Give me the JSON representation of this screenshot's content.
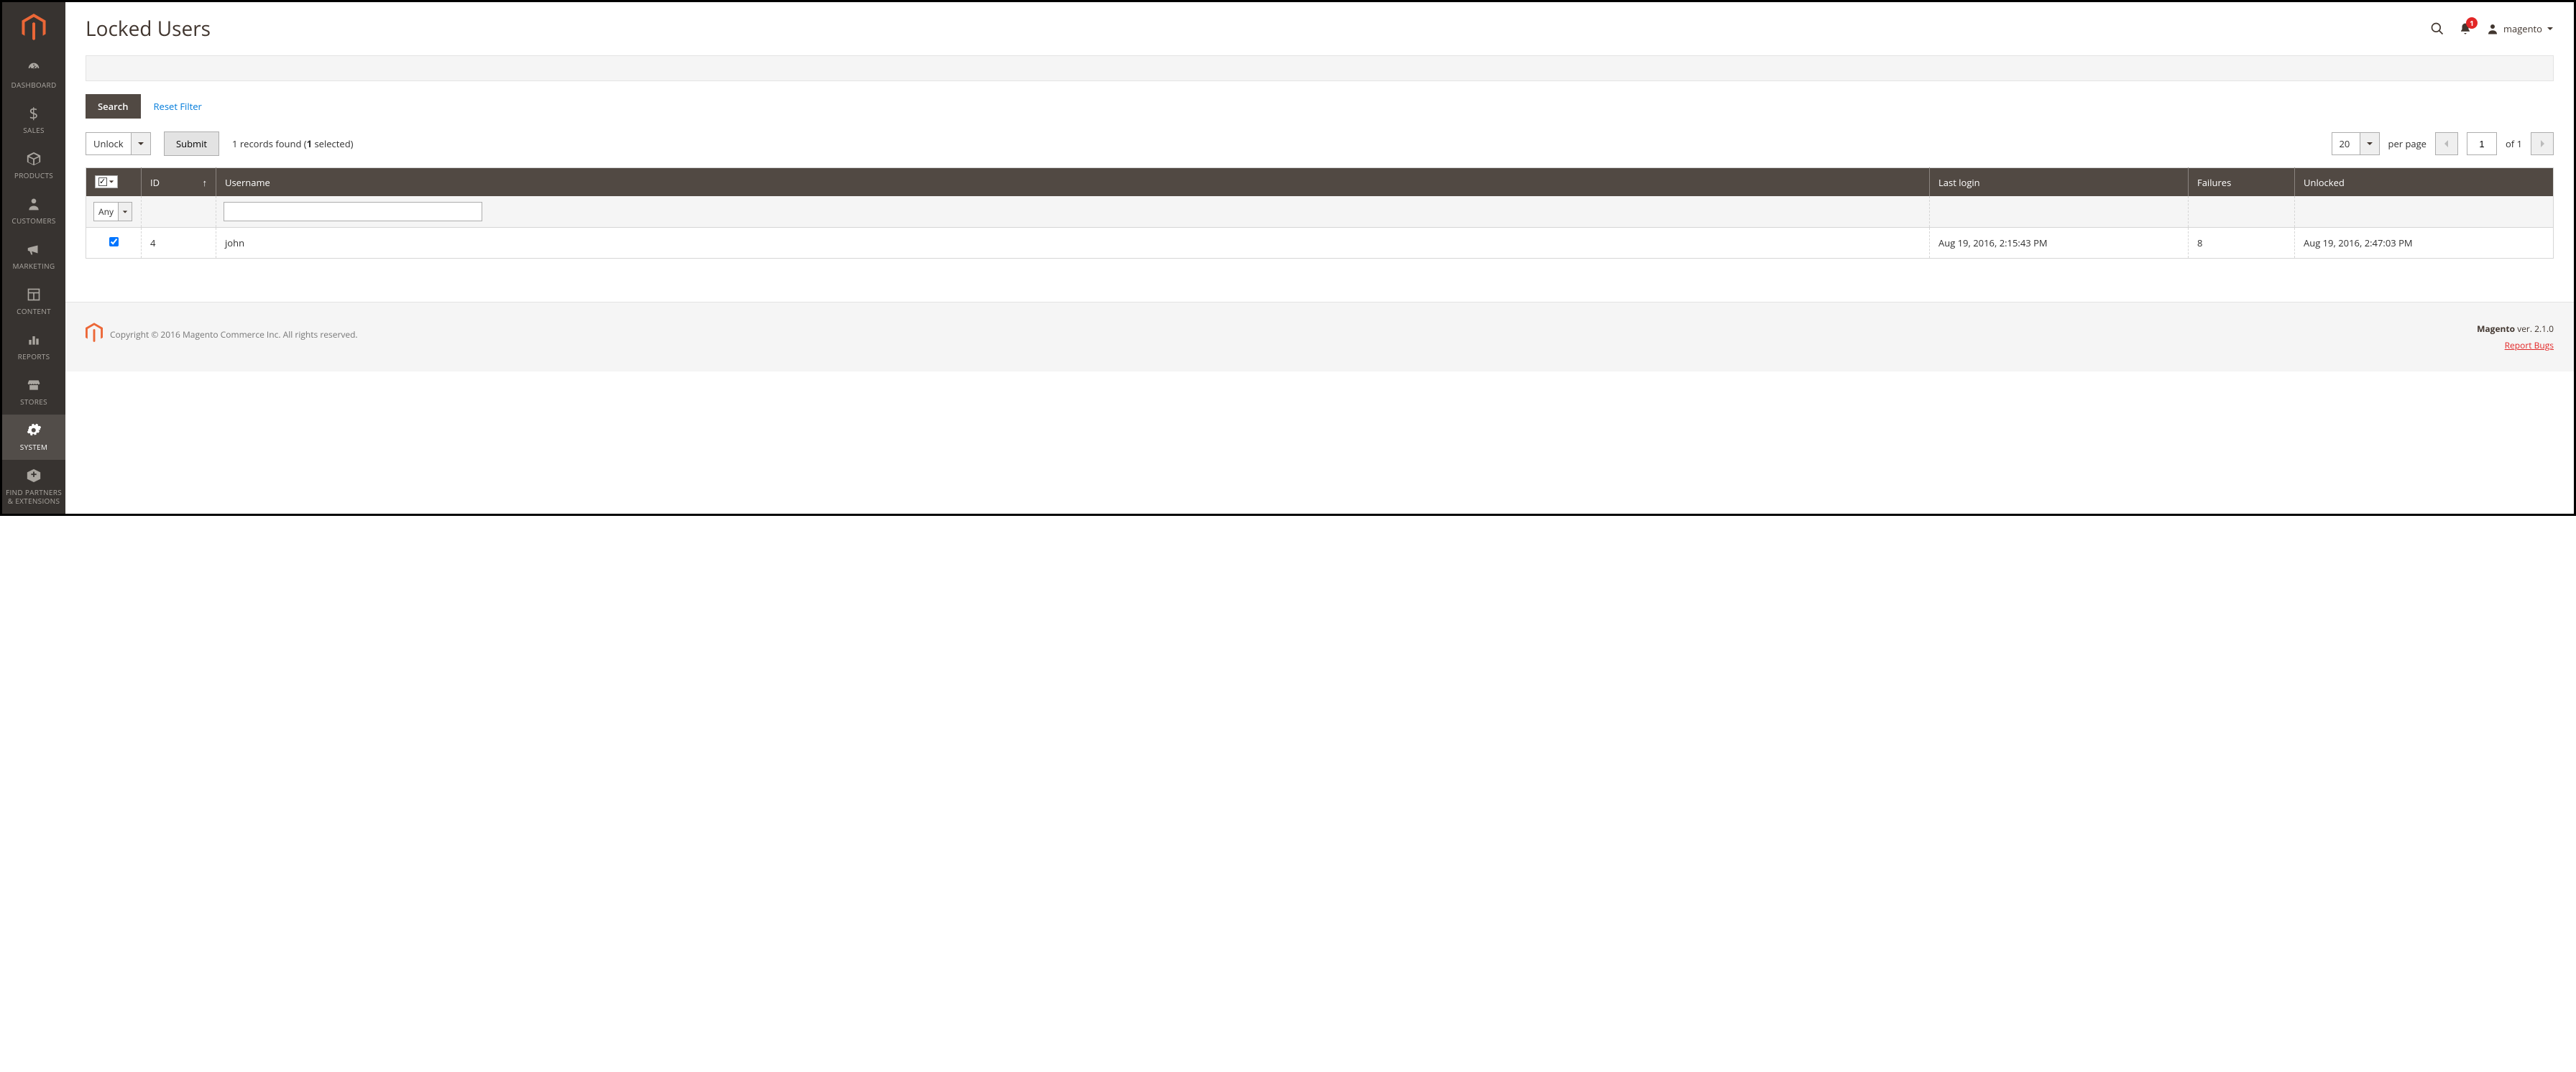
{
  "sidebar": {
    "items": [
      {
        "label": "DASHBOARD"
      },
      {
        "label": "SALES"
      },
      {
        "label": "PRODUCTS"
      },
      {
        "label": "CUSTOMERS"
      },
      {
        "label": "MARKETING"
      },
      {
        "label": "CONTENT"
      },
      {
        "label": "REPORTS"
      },
      {
        "label": "STORES"
      },
      {
        "label": "SYSTEM"
      },
      {
        "label": "FIND PARTNERS & EXTENSIONS"
      }
    ]
  },
  "header": {
    "title": "Locked Users",
    "notification_count": "1",
    "user_label": "magento"
  },
  "controls": {
    "search_label": "Search",
    "reset_filter_label": "Reset Filter",
    "action_select": "Unlock",
    "submit_label": "Submit",
    "records_found_prefix": "1 records found (",
    "records_found_bold": "1",
    "records_found_suffix": " selected)",
    "per_page_value": "20",
    "per_page_label": "per page",
    "page_current": "1",
    "page_total_prefix": "of ",
    "page_total": "1",
    "filter_any": "Any"
  },
  "table": {
    "columns": {
      "id": "ID",
      "username": "Username",
      "last_login": "Last login",
      "failures": "Failures",
      "unlocked": "Unlocked"
    },
    "rows": [
      {
        "id": "4",
        "username": "john",
        "last_login": "Aug 19, 2016, 2:15:43 PM",
        "failures": "8",
        "unlocked": "Aug 19, 2016, 2:47:03 PM"
      }
    ]
  },
  "footer": {
    "copyright": "Copyright © 2016 Magento Commerce Inc. All rights reserved.",
    "version_prefix": "Magento",
    "version": " ver. 2.1.0",
    "report_bugs": "Report Bugs"
  }
}
